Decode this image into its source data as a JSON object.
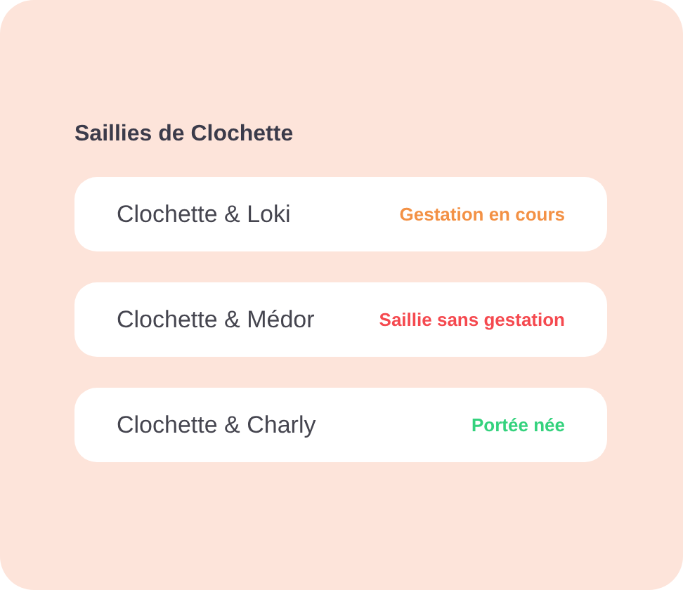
{
  "title": "Saillies de Clochette",
  "matings": [
    {
      "name": "Clochette & Loki",
      "status": "Gestation en cours",
      "color": "#f39145"
    },
    {
      "name": "Clochette & Médor",
      "status": "Saillie sans gestation",
      "color": "#f5494f"
    },
    {
      "name": "Clochette & Charly",
      "status": "Portée née",
      "color": "#34d27d"
    }
  ]
}
